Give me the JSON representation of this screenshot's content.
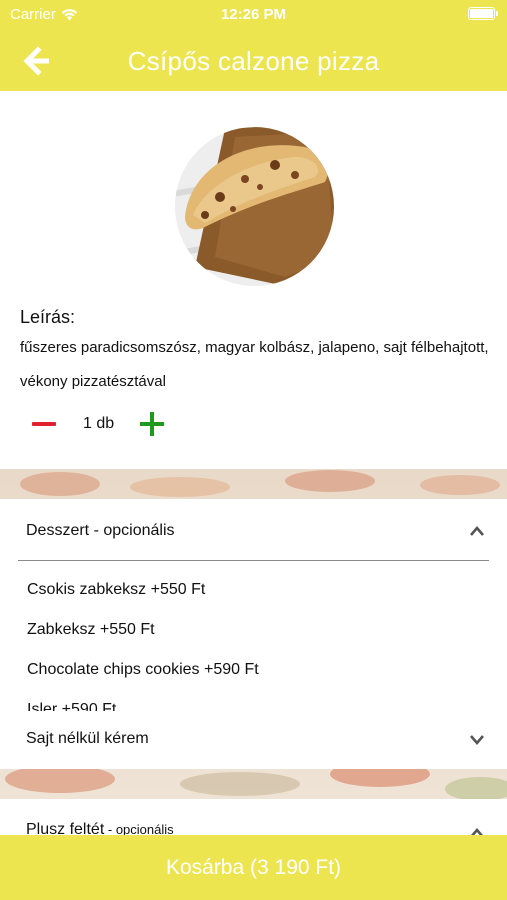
{
  "status_bar": {
    "carrier": "Carrier",
    "time": "12:26 PM",
    "icons": [
      "wifi-icon",
      "battery-icon"
    ]
  },
  "header": {
    "title": "Csípős calzone pizza",
    "back_icon": "arrow-left-icon",
    "color": "#ede54f"
  },
  "product": {
    "image": "calzone-pizza-photo",
    "description_label": "Leírás:",
    "description": "fűszeres paradicsomszósz, magyar kolbász, jalapeno, sajt félbehajtott, vékony pizzatésztával"
  },
  "quantity": {
    "value": "1 db",
    "minus_color": "#e0202a",
    "plus_color": "#1e9a1e"
  },
  "sections": {
    "dessert": {
      "label": "Desszert - opcionális",
      "expanded": true,
      "options": [
        "Csokis zabkeksz +550 Ft",
        "Zabkeksz +550 Ft",
        "Chocolate chips cookies +590 Ft",
        "Isler +590 Ft"
      ]
    },
    "no_cheese": {
      "label": "Sajt nélkül kérem",
      "expanded": false
    },
    "extra_topping": {
      "label": "Plusz feltét",
      "label_suffix": " - opcionális",
      "expanded": true
    }
  },
  "cart_button": {
    "label": "Kosárba (3 190 Ft)"
  }
}
